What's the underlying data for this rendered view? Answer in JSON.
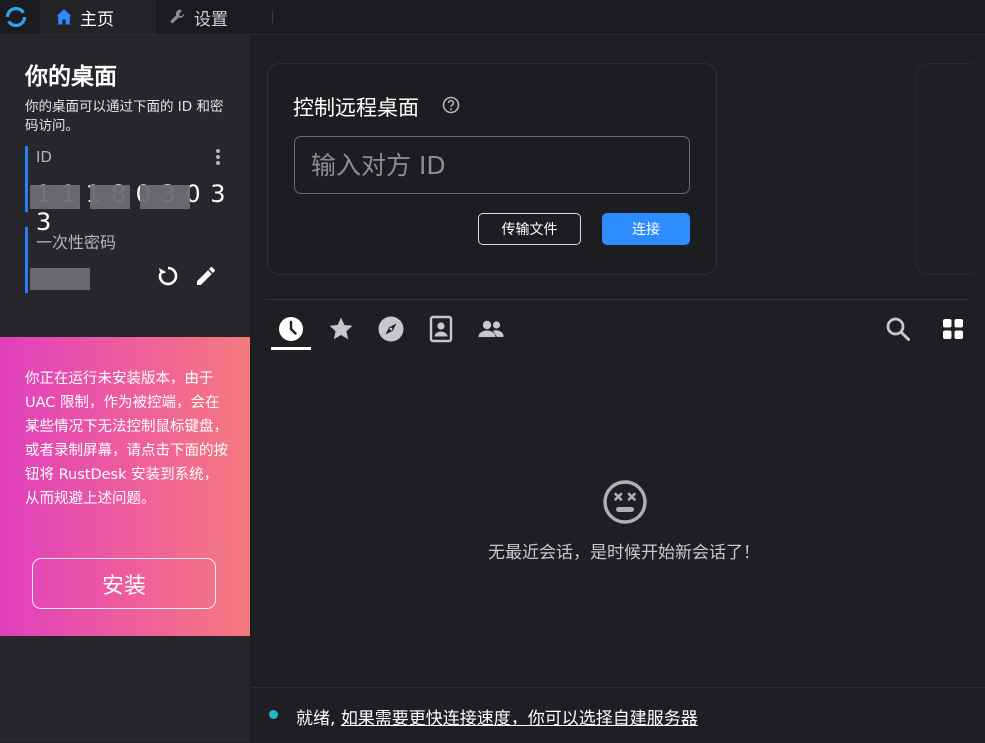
{
  "tabs": [
    {
      "label": "主页",
      "icon": "home-icon",
      "active": true
    },
    {
      "label": "设置",
      "icon": "wrench-icon",
      "active": false
    }
  ],
  "left": {
    "title": "你的桌面",
    "description": "你的桌面可以通过下面的 ID 和密码访问。",
    "id_label": "ID",
    "id_value": "1 1 1  8 0 3  0 3 3",
    "password_label": "一次性密码",
    "warning": "你正在运行未安装版本，由于 UAC 限制，作为被控端，会在某些情况下无法控制鼠标键盘，或者录制屏幕，请点击下面的按钮将 RustDesk 安装到系统，从而规避上述问题。",
    "install_label": "安装"
  },
  "connect": {
    "title": "控制远程桌面",
    "input_placeholder": "输入对方 ID",
    "input_value": "",
    "transfer_label": "传输文件",
    "connect_label": "连接"
  },
  "peer_tabs": [
    "clock-icon",
    "star-icon",
    "compass-icon",
    "address-book-icon",
    "group-icon"
  ],
  "empty_text": "无最近会话，是时候开始新会话了！",
  "status": {
    "ready": "就绪,",
    "link": "如果需要更快连接速度，你可以选择自建服务器"
  },
  "colors": {
    "accent": "#2d8cff",
    "status_dot": "#23b9c4",
    "warning_gradient_start": "#e03fbe",
    "warning_gradient_end": "#f47a7e"
  }
}
